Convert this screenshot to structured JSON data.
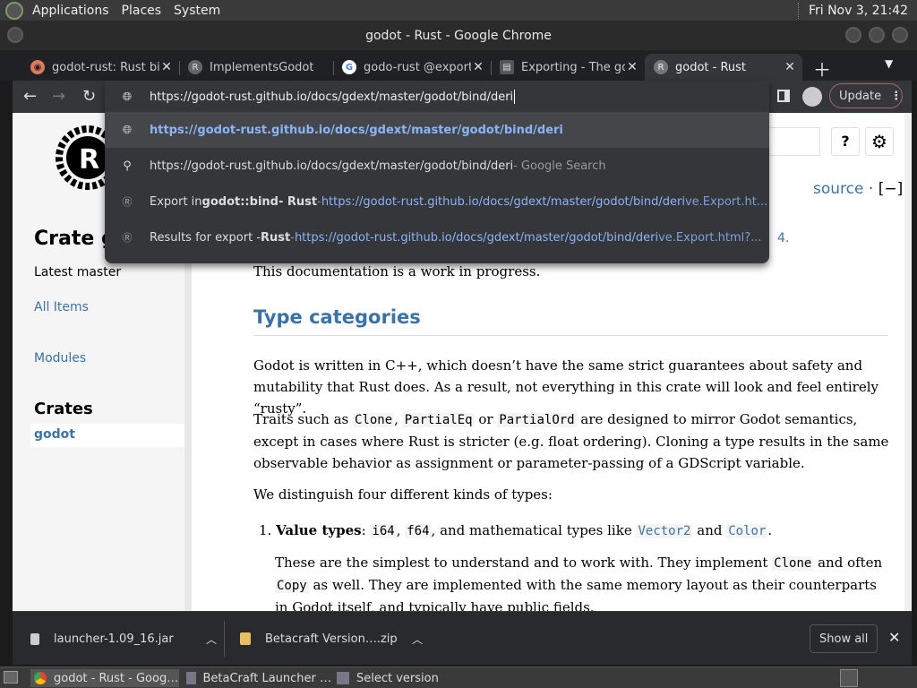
{
  "panel": {
    "menus": [
      "Applications",
      "Places",
      "System"
    ],
    "clock": "Fri Nov  3, 21:42"
  },
  "window": {
    "title": "godot - Rust - Google Chrome"
  },
  "tabs": [
    {
      "title": "godot-rust: Rust bi",
      "close": "✕"
    },
    {
      "title": "ImplementsGodotE",
      "close": ""
    },
    {
      "title": "godo-rust @export",
      "close": "✕"
    },
    {
      "title": "Exporting - The gdr",
      "close": "✕"
    },
    {
      "title": "godot - Rust",
      "close": "✕"
    }
  ],
  "toolbar": {
    "url": "https://godot-rust.github.io/docs/gdext/master/godot/bind/deri",
    "update_label": "Update"
  },
  "omnibox": {
    "suggestions": [
      {
        "main": "https://godot-rust.github.io/docs/gdext/master/godot/bind/deri",
        "pre": "",
        "bold": "",
        "post": "",
        "sep": "",
        "url": "",
        "rest": ""
      },
      {
        "main": "https://godot-rust.github.io/docs/gdext/master/godot/bind/deri",
        "pre": "",
        "bold": "",
        "post": "",
        "sep": " - Google Search",
        "url": "",
        "rest": ""
      },
      {
        "main": "",
        "pre": "Export in ",
        "bold": "godot::bind",
        "post": " - Rust",
        "sep": " - ",
        "url": "https://godot-rust.github.io/docs/gdext/master/godot/bind/deri",
        "rest": "ve.Export.ht..."
      },
      {
        "main": "",
        "pre": "Results for export - ",
        "bold": "Rust",
        "post": "",
        "sep": " - ",
        "url": "https://godot-rust.github.io/docs/gdext/master/godot/bind/deri",
        "rest": "ve.Export.html?..."
      }
    ]
  },
  "sidebar": {
    "crate_title": "Crate go",
    "version": "Latest master",
    "all_items": "All Items",
    "modules": "Modules",
    "crates_heading": "Crates",
    "crate": "godot"
  },
  "doc": {
    "source": "source",
    "toggle": "[−]",
    "version_tail": "4.",
    "wip": "This documentation is a work in progress.",
    "h_type_categories": "Type categories",
    "p1": "Godot is written in C++, which doesn’t have the same strict guarantees about safety and mutability that Rust does. As a result, not everything in this crate will look and feel entirely “rusty”.",
    "p2_a": "Traits such as ",
    "p2_clone": "Clone",
    "p2_b": ", ",
    "p2_peq": "PartialEq",
    "p2_c": " or ",
    "p2_pord": "PartialOrd",
    "p2_d": " are designed to mirror Godot semantics, except in cases where Rust is stricter (e.g. float ordering). Cloning a type results in the same observable behavior as assignment or parameter-passing of a GDScript variable.",
    "p3": "We distinguish four different kinds of types:",
    "li1_num": "1.",
    "li1_bold": "Value types",
    "li1_a": ": ",
    "li1_i64": "i64",
    "li1_b": ", ",
    "li1_f64": "f64",
    "li1_c": ", and mathematical types like ",
    "li1_vec": "Vector2",
    "li1_d": " and ",
    "li1_color": "Color",
    "li1_e": ".",
    "li1_p_a": "These are the simplest to understand and to work with. They implement ",
    "li1_p_clone": "Clone",
    "li1_p_b": " and often ",
    "li1_p_copy": "Copy",
    "li1_p_c": " as well. They are implemented with the same memory layout as their counterparts in Godot itself, and typically have public fields."
  },
  "downloads": {
    "file1": "launcher-1.09_16.jar",
    "file2": "Betacraft Version….zip",
    "show_all": "Show all"
  },
  "taskbar": {
    "items": [
      "godot - Rust - Goog…",
      "BetaCraft Launcher …",
      "Select version"
    ]
  }
}
